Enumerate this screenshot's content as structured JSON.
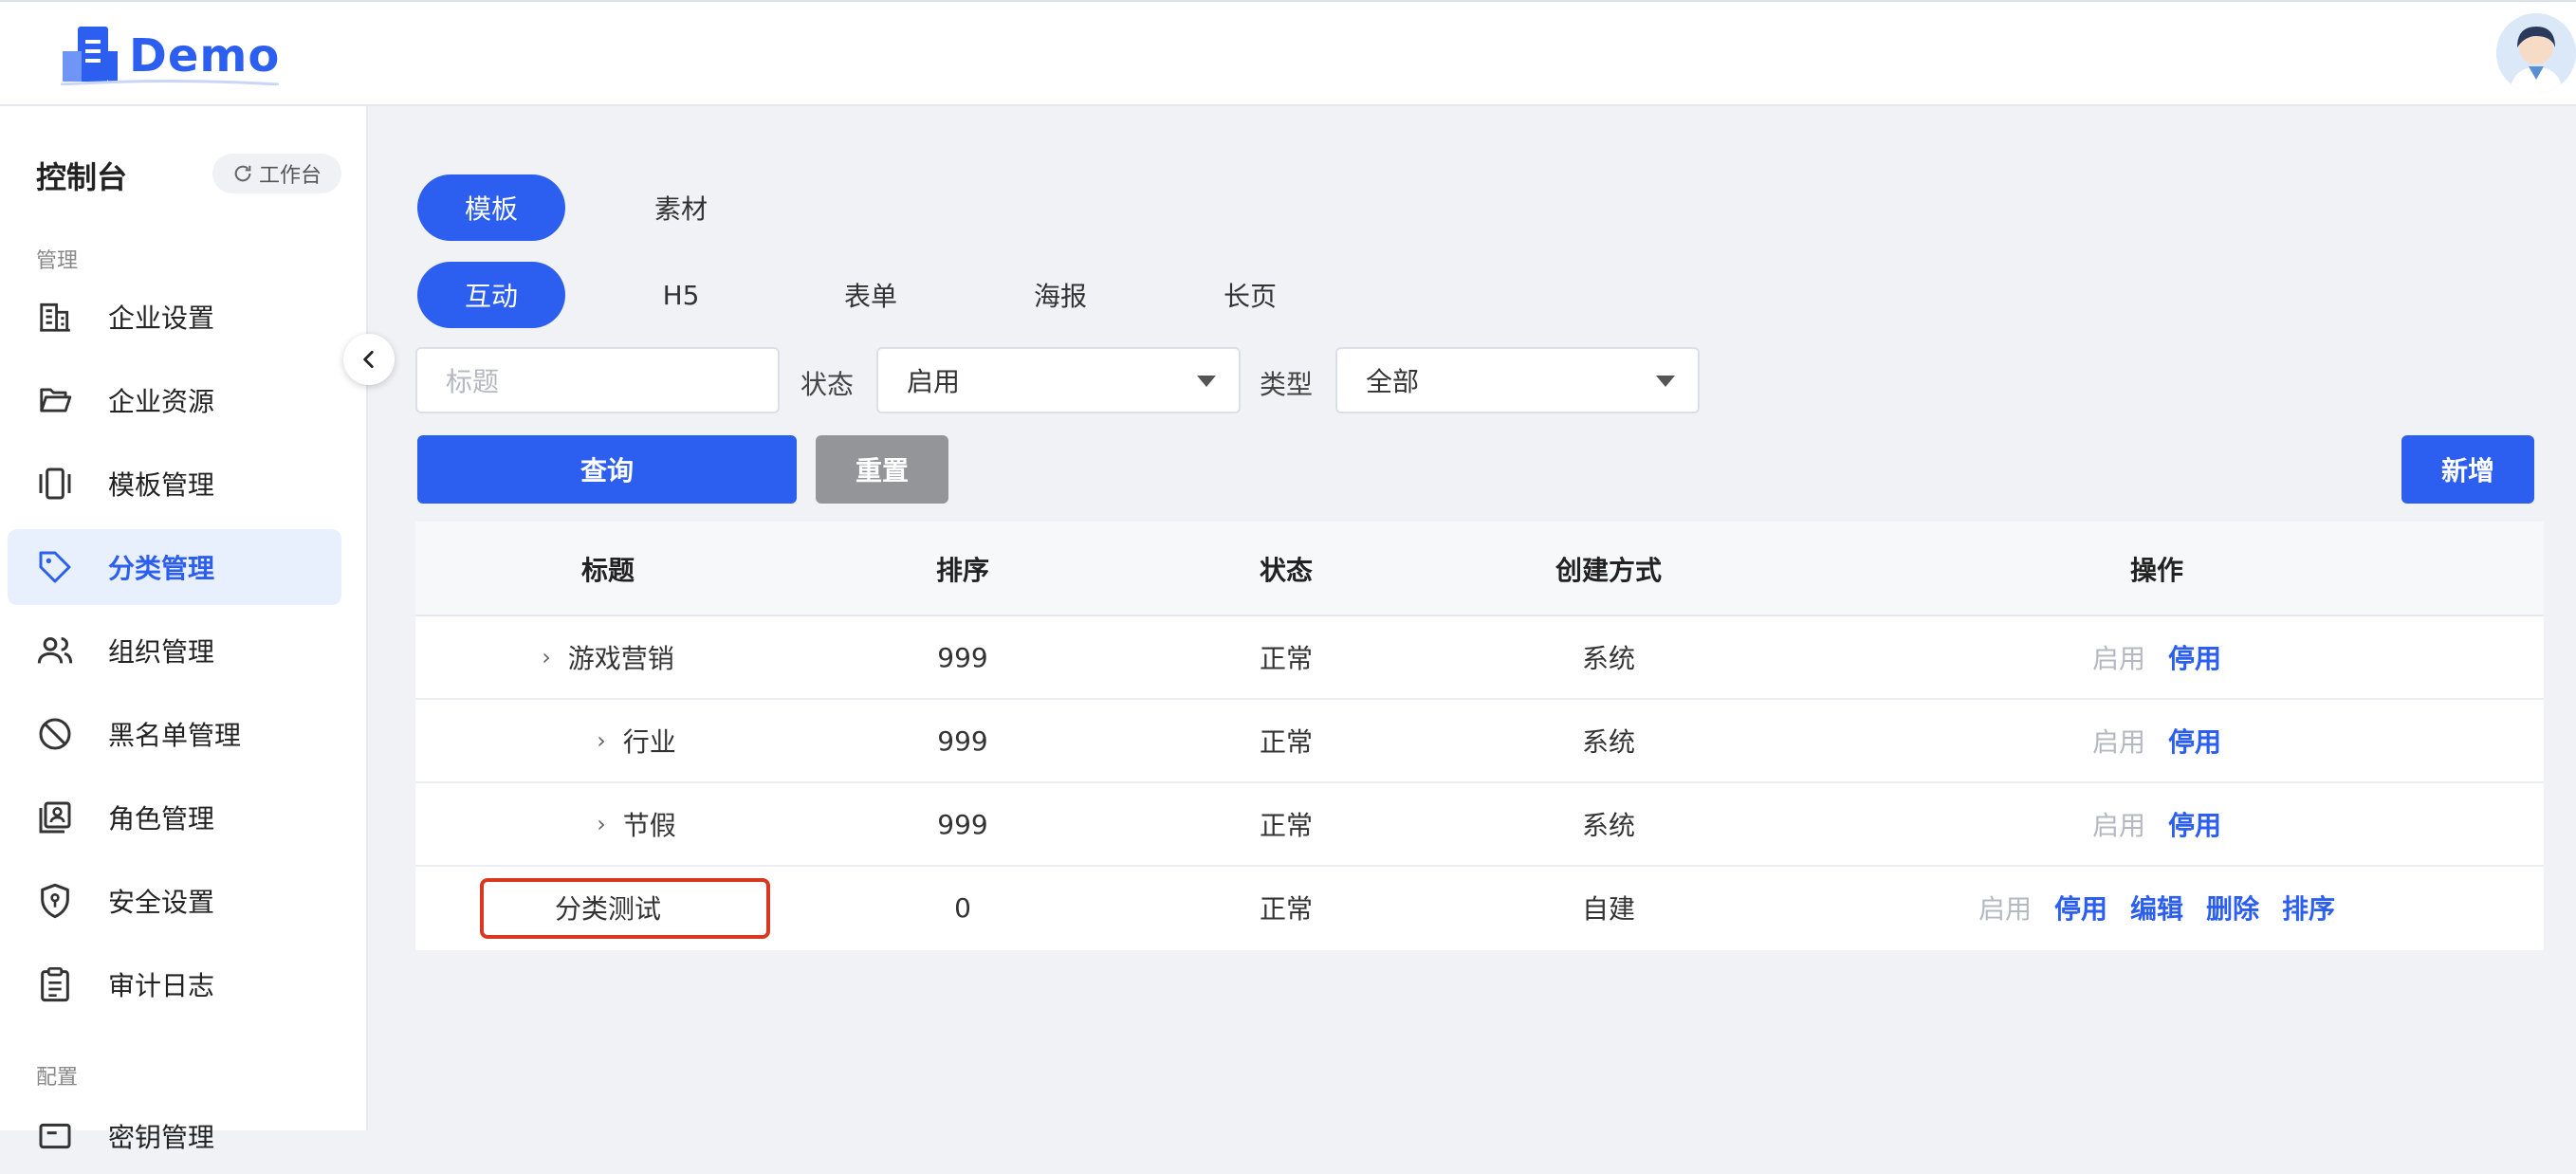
{
  "app": {
    "logo_text": "Demo"
  },
  "sidebar": {
    "console_title": "控制台",
    "workbench_label": "工作台",
    "section_manage": "管理",
    "items": [
      {
        "label": "企业设置",
        "icon": "building-icon"
      },
      {
        "label": "企业资源",
        "icon": "folder-icon"
      },
      {
        "label": "模板管理",
        "icon": "template-icon"
      },
      {
        "label": "分类管理",
        "icon": "tag-icon",
        "active": true
      },
      {
        "label": "组织管理",
        "icon": "users-icon"
      },
      {
        "label": "黑名单管理",
        "icon": "ban-icon"
      },
      {
        "label": "角色管理",
        "icon": "role-icon"
      },
      {
        "label": "安全设置",
        "icon": "shield-icon"
      },
      {
        "label": "审计日志",
        "icon": "clipboard-icon"
      }
    ],
    "section_config": "配置",
    "partial_item": "密钥管理"
  },
  "main": {
    "top_tabs": [
      {
        "label": "模板",
        "active": true
      },
      {
        "label": "素材"
      }
    ],
    "sub_tabs": [
      {
        "label": "互动",
        "active": true
      },
      {
        "label": "H5"
      },
      {
        "label": "表单"
      },
      {
        "label": "海报"
      },
      {
        "label": "长页"
      }
    ],
    "filters": {
      "title_placeholder": "标题",
      "status_label": "状态",
      "status_value": "启用",
      "type_label": "类型",
      "type_value": "全部"
    },
    "buttons": {
      "query": "查询",
      "reset": "重置",
      "add": "新增"
    }
  },
  "table": {
    "headers": [
      "标题",
      "排序",
      "状态",
      "创建方式",
      "操作"
    ],
    "rows": [
      {
        "title": "游戏营销",
        "sort": "999",
        "status": "正常",
        "method": "系统",
        "expandable": true,
        "actions": [
          "启用",
          "停用"
        ]
      },
      {
        "title": "行业",
        "sort": "999",
        "status": "正常",
        "method": "系统",
        "expandable": true,
        "actions": [
          "启用",
          "停用"
        ]
      },
      {
        "title": "节假",
        "sort": "999",
        "status": "正常",
        "method": "系统",
        "expandable": true,
        "actions": [
          "启用",
          "停用"
        ]
      },
      {
        "title": "分类测试",
        "sort": "0",
        "status": "正常",
        "method": "自建",
        "expandable": false,
        "actions": [
          "启用",
          "停用",
          "编辑",
          "删除",
          "排序"
        ]
      }
    ]
  },
  "colors": {
    "primary": "#2c5ef0",
    "highlight": "#d9371f"
  }
}
